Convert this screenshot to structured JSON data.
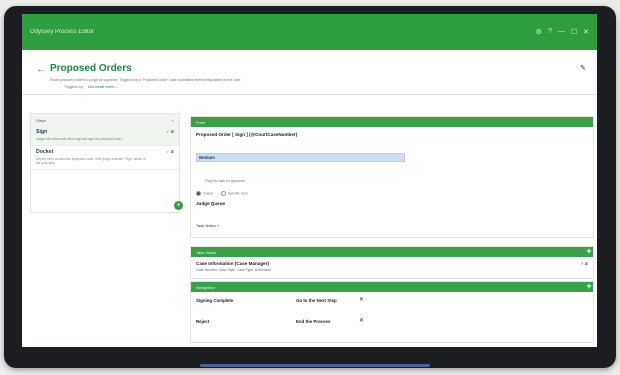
{
  "window": {
    "title": "Odyssey Process Editor",
    "controls": [
      "⚙",
      "?",
      "—",
      "☐",
      "✕"
    ]
  },
  "header": {
    "title": "Proposed Orders",
    "description": "Route proposed orders to judge for signature. Triggered by a \"Proposed Order\" case docketable event being added to the case.",
    "triggered_by_label": "Triggered by:",
    "triggered_by_value": "Doc create event ⌄"
  },
  "steps_panel": {
    "title": "Steps",
    "add_icon": "+",
    "items": [
      {
        "name": "Sign",
        "description": "Judge will review and either sign/not sign the proposed order.",
        "actions": "✓ ⊠",
        "active": true
      },
      {
        "name": "Docket",
        "description": "Deputy clerk dockets the proposed order, if the judge selected \"Sign\" action in the prior step.",
        "actions": "✓ ⊠",
        "active": false
      }
    ]
  },
  "form_section": {
    "bar_label": "Form",
    "order_label": "Proposed Order [ Sign ] (@CourtCaseNumber)",
    "priority_value": "Medium",
    "checkbox_text": "Flag this task for signature",
    "radio_queue": "Queue",
    "radio_user": "Specific User",
    "judge_queue_label": "Judge Queue",
    "task_notes": "Task Notes +"
  },
  "task_views": {
    "bar_label": "Task Views",
    "card_title": "Case Information (Case Manager)",
    "card_sub": "Case Number, Case Style, Case Type, Defendant",
    "card_actions": "↗ ⊠"
  },
  "navigation": {
    "bar_label": "Navigation",
    "rows": [
      {
        "name": "Signing Complete",
        "target": "Go to the Next Step",
        "remove": "✕"
      },
      {
        "name": "Reject",
        "target": "End the Process",
        "remove": "✕"
      }
    ]
  },
  "icons": {
    "back": "←",
    "edit": "✎",
    "add": "+"
  }
}
